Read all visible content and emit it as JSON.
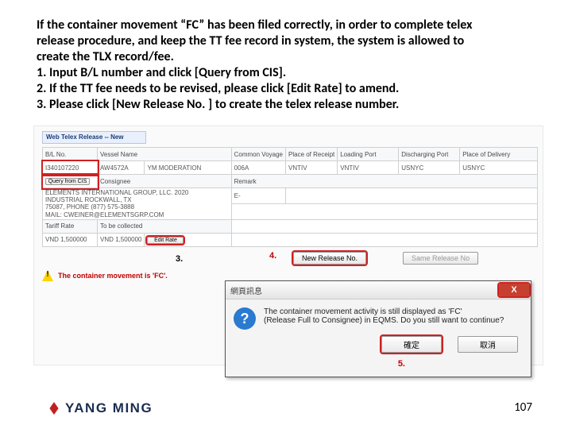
{
  "instruction": {
    "p1": "If the container movement “FC” has been filed correctly, in order to complete telex",
    "p2": "release procedure, and keep the TT fee record in system, the system is allowed to",
    "p3": "create the TLX record/fee.",
    "l1": "1. Input B/L number and click [Query from CIS].",
    "l2": "2. If the TT fee needs to be revised, please click [Edit Rate] to amend.",
    "l3": "3. Please click [New Release No. ] to create the telex release number."
  },
  "window": {
    "title": "Web Telex Release -- New"
  },
  "headers": {
    "blno": "B/L No.",
    "vessel_name": "Vessel Name",
    "common_voyage": "Common Voyage",
    "place_of_receipt": "Place of Receipt",
    "loading_port": "Loading Port",
    "discharging_port": "Discharging Port",
    "place_of_delivery": "Place of Delivery",
    "consignee": "Consignee",
    "remark": "Remark",
    "tariff_rate": "Tariff Rate",
    "to_be_collected": "To be collected"
  },
  "values": {
    "blno": "I340107220",
    "vessel_name": "AW4572A",
    "vessel_name2": "YM MODERATION",
    "common_voyage": "006A",
    "place_of_receipt": "VNTIV",
    "loading_port": "VNTIV",
    "discharging_port": "USNYC",
    "place_of_delivery": "USNYC",
    "consignee_line1": "ELEMENTS INTERNATIONAL GROUP, LLC. 2020",
    "consignee_line2": "INDUSTRIAL          ROCKWALL, TX",
    "consignee_line3": "75087,     PHONE (877) 575-3888",
    "consignee_line4": "MAIL: CWEINER@ELEMENTSGRP.COM",
    "email_type": "E-",
    "tariff_rate": "VND 1,500000",
    "to_be_collected": "VND 1,500000"
  },
  "buttons": {
    "query_cis": "Query from CIS",
    "edit_rate": "Edit Rate",
    "new_release": "New Release No.",
    "same_release": "Same Release No",
    "ok": "確定",
    "cancel": "取消"
  },
  "warning_text": "The container movement is 'FC'.",
  "steps": {
    "s1": "1.",
    "s2": "2.",
    "s3": "3.",
    "s4": "4.",
    "s5": "5."
  },
  "modal": {
    "title": "網頁訊息",
    "line1": "The container movement activity is still displayed as 'FC'",
    "line2": "(Release Full to Consignee) in EQMS. Do you still want to continue?",
    "x": "X"
  },
  "footer": {
    "brand": "YANG MING",
    "page": "107"
  }
}
